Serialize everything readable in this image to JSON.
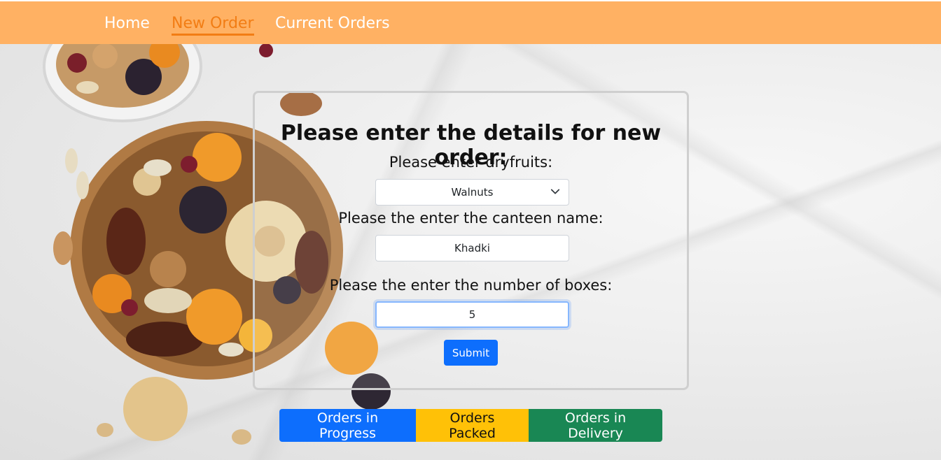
{
  "nav": {
    "items": [
      {
        "label": "Home",
        "active": false
      },
      {
        "label": "New Order",
        "active": true
      },
      {
        "label": "Current Orders",
        "active": false
      }
    ]
  },
  "form": {
    "heading": "Please enter the details for new order:",
    "dryfruit_label": "Please enter dryfruits:",
    "dryfruit_selected": "Walnuts",
    "canteen_label": "Please the enter the canteen name:",
    "canteen_value": "Khadki",
    "boxes_label": "Please the enter the number of boxes:",
    "boxes_value": "5",
    "submit_label": "Submit"
  },
  "status_buttons": {
    "in_progress": "Orders in Progress",
    "packed": "Orders Packed",
    "in_delivery": "Orders in Delivery"
  },
  "colors": {
    "navbar": "#ffb163",
    "nav_active": "#f27d14",
    "primary": "#0d6efd",
    "warning": "#ffc107",
    "success": "#198754"
  },
  "icons": {
    "select_chevron": "chevron-down-icon",
    "background": "dryfruits-bowl-image"
  }
}
